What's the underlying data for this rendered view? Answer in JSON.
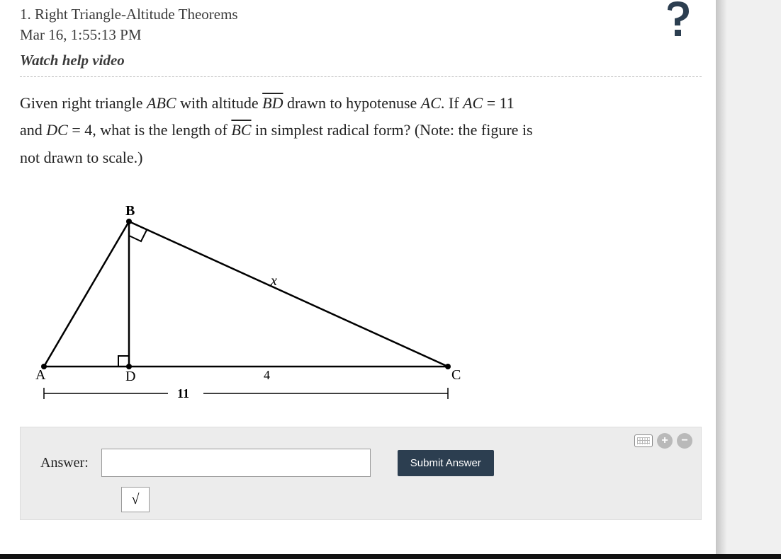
{
  "header": {
    "problem_number": "1.",
    "problem_title": "Right Triangle-Altitude Theorems",
    "timestamp": "Mar 16, 1:55:13 PM",
    "help_link": "Watch help video"
  },
  "problem": {
    "line1_prefix": "Given right triangle ",
    "triangle": "ABC",
    "line1_mid1": " with altitude ",
    "altitude": "BD",
    "line1_mid2": " drawn to hypotenuse ",
    "hypotenuse": "AC",
    "line1_mid3": ". If ",
    "eq1_lhs": "AC",
    "eq1_eq": " = ",
    "eq1_rhs": "11",
    "line2_prefix": "and ",
    "eq2_lhs": "DC",
    "eq2_eq": " = ",
    "eq2_rhs": "4",
    "line2_mid1": ", what is the length of ",
    "target": "BC",
    "line2_mid2": " in simplest radical form? (Note: the figure is",
    "line3": "not drawn to scale.)"
  },
  "diagram": {
    "labels": {
      "A": "A",
      "B": "B",
      "C": "C",
      "D": "D",
      "x": "x",
      "dc": "4",
      "ac": "11"
    }
  },
  "answer_panel": {
    "label": "Answer:",
    "input_value": "",
    "submit_label": "Submit Answer",
    "sqrt_symbol": "√"
  }
}
